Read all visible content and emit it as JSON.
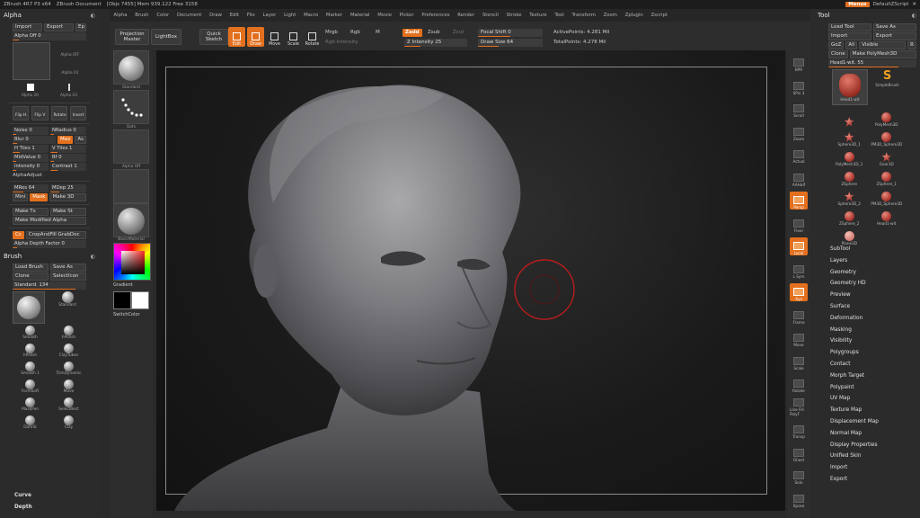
{
  "titlebar": {
    "app": "ZBrush 4R7 P3 x64",
    "document": "ZBrush Document",
    "stats": "[Objs 7455]  Mem 939.122  Free 3158",
    "menus_chip": "Menus",
    "script": "DefaultZScript"
  },
  "menubar": [
    "Alpha",
    "Brush",
    "Color",
    "Document",
    "Draw",
    "Edit",
    "File",
    "Layer",
    "Light",
    "Macro",
    "Marker",
    "Material",
    "Movie",
    "Picker",
    "Preferences",
    "Render",
    "Stencil",
    "Stroke",
    "Texture",
    "Tool",
    "Transform",
    "Zoom",
    "Zplugin",
    "Zscript"
  ],
  "shelf": {
    "projection_master": "Projection Master",
    "lightbox": "LightBox",
    "quick_sketch": "Quick Sketch",
    "modes": [
      "Edit",
      "Draw",
      "Move",
      "Scale",
      "Rotate"
    ],
    "mrgb": "Mrgb",
    "rgb": "Rgb",
    "m": "M",
    "zadd": "Zadd",
    "zsub": "Zsub",
    "zcut": "Zcut",
    "rgb_intensity": "Rgb Intensity",
    "z_intensity": "Z Intensity 25",
    "z_intensity_value": 25,
    "focal_shift": "Focal Shift 0",
    "draw_size": "Draw Size 64",
    "draw_size_value": 64,
    "active_points": "ActivePoints: 4.281 Mil",
    "total_points": "TotalPoints: 4.278 Mil"
  },
  "alpha": {
    "title": "Alpha",
    "import": "Import",
    "export": "Export",
    "ep": "Ep",
    "alpha_off": "Alpha Off 0",
    "labels": [
      "Alpha 0FF",
      "Alpha 01",
      "Alpha 20",
      "Alpha 03"
    ],
    "tools": [
      "Flip H",
      "Flip V",
      "Rotate",
      "Invert"
    ],
    "sliders_a": [
      "Noise 0",
      "NRadius 0",
      "Blur 0",
      "Max",
      "As",
      "H Tiles 1",
      "V Tiles 1",
      "MidValue 0",
      "Rf 0",
      "Intensity 0",
      "Contrast 1"
    ],
    "alpha_adjust": "AlphaAdjust",
    "sliders_b": [
      "MRes 64",
      "MDep 25",
      "Mini",
      "Mask",
      "Make 3D"
    ],
    "make_tx": "Make Tx",
    "make_st": "Make St",
    "make_modified": "Make Modified Alpha",
    "cc": "Cc",
    "grab_doc": "CropAndFill  GrabDoc",
    "depth_factor": "Alpha Depth Factor 0"
  },
  "brush": {
    "title": "Brush",
    "load": "Load Brush",
    "save": "Save As",
    "clone": "Clone",
    "select_icon": "SelectIcon",
    "current": "Standard. 134",
    "standard_label": "Standard",
    "items": [
      "Standard",
      "Standard",
      "Smooth",
      "hPolish",
      "hPolish",
      "ClayTubes",
      "Smooth 1",
      "TrimDynamic",
      "FormSoft",
      "Move",
      "MaskPen",
      "SelectRect",
      "DamSt",
      "Clay"
    ]
  },
  "left_footer": [
    "Curve",
    "Depth"
  ],
  "tray": {
    "labels": [
      "Standard",
      "Dots",
      "Alpha Off",
      "Texture Off",
      "BasicMaterial"
    ],
    "gradient": "Gradient",
    "switch_color": "SwitchColor"
  },
  "right_shelf": [
    "BPR",
    "SPix 3",
    "Scroll",
    "Zoom",
    "Actual",
    "AAHalf",
    "Persp",
    "Floor",
    "Local",
    "L.Sym",
    "Xyz",
    "Frame",
    "Move",
    "Scale",
    "Rotate",
    "Line Fill PolyF",
    "Transp",
    "Ghost",
    "Solo",
    "Xpose"
  ],
  "tool": {
    "title": "Tool",
    "load": "Load Tool",
    "save": "Save As",
    "import": "Import",
    "export": "Export",
    "goz": "GoZ",
    "all": "All",
    "visible": "Visible",
    "r": "R",
    "clone": "Clone",
    "make_polymesh": "Make PolyMesh3D",
    "current": "Head1-wit. 55",
    "items": [
      "Head1-wit",
      "SimpleBrush",
      "",
      "PolyMesh3D",
      "Sphere3D_1",
      "PM3D_Sphere3D",
      "PolyMesh3D_1",
      "Gear3D",
      "ZSphere",
      "ZSphere_1",
      "Sphere3D_2",
      "PM3D_Sphere3D",
      "ZSphere_2",
      "Head1-wit",
      "Plane3D"
    ],
    "menu": [
      "SubTool",
      "Layers",
      "Geometry",
      "Geometry HD",
      "Preview",
      "Surface",
      "Deformation",
      "Masking",
      "Visibility",
      "Polygroups",
      "Contact",
      "Morph Target",
      "Polypaint",
      "UV Map",
      "Texture Map",
      "Displacement Map",
      "Normal Map",
      "Display Properties",
      "Unified Skin",
      "Import",
      "Export"
    ]
  },
  "colors": {
    "accent": "#e3701e",
    "panel": "#2b2b2b",
    "canvas": "#1a1a1a",
    "cursor_ring": "#b81c1c"
  }
}
